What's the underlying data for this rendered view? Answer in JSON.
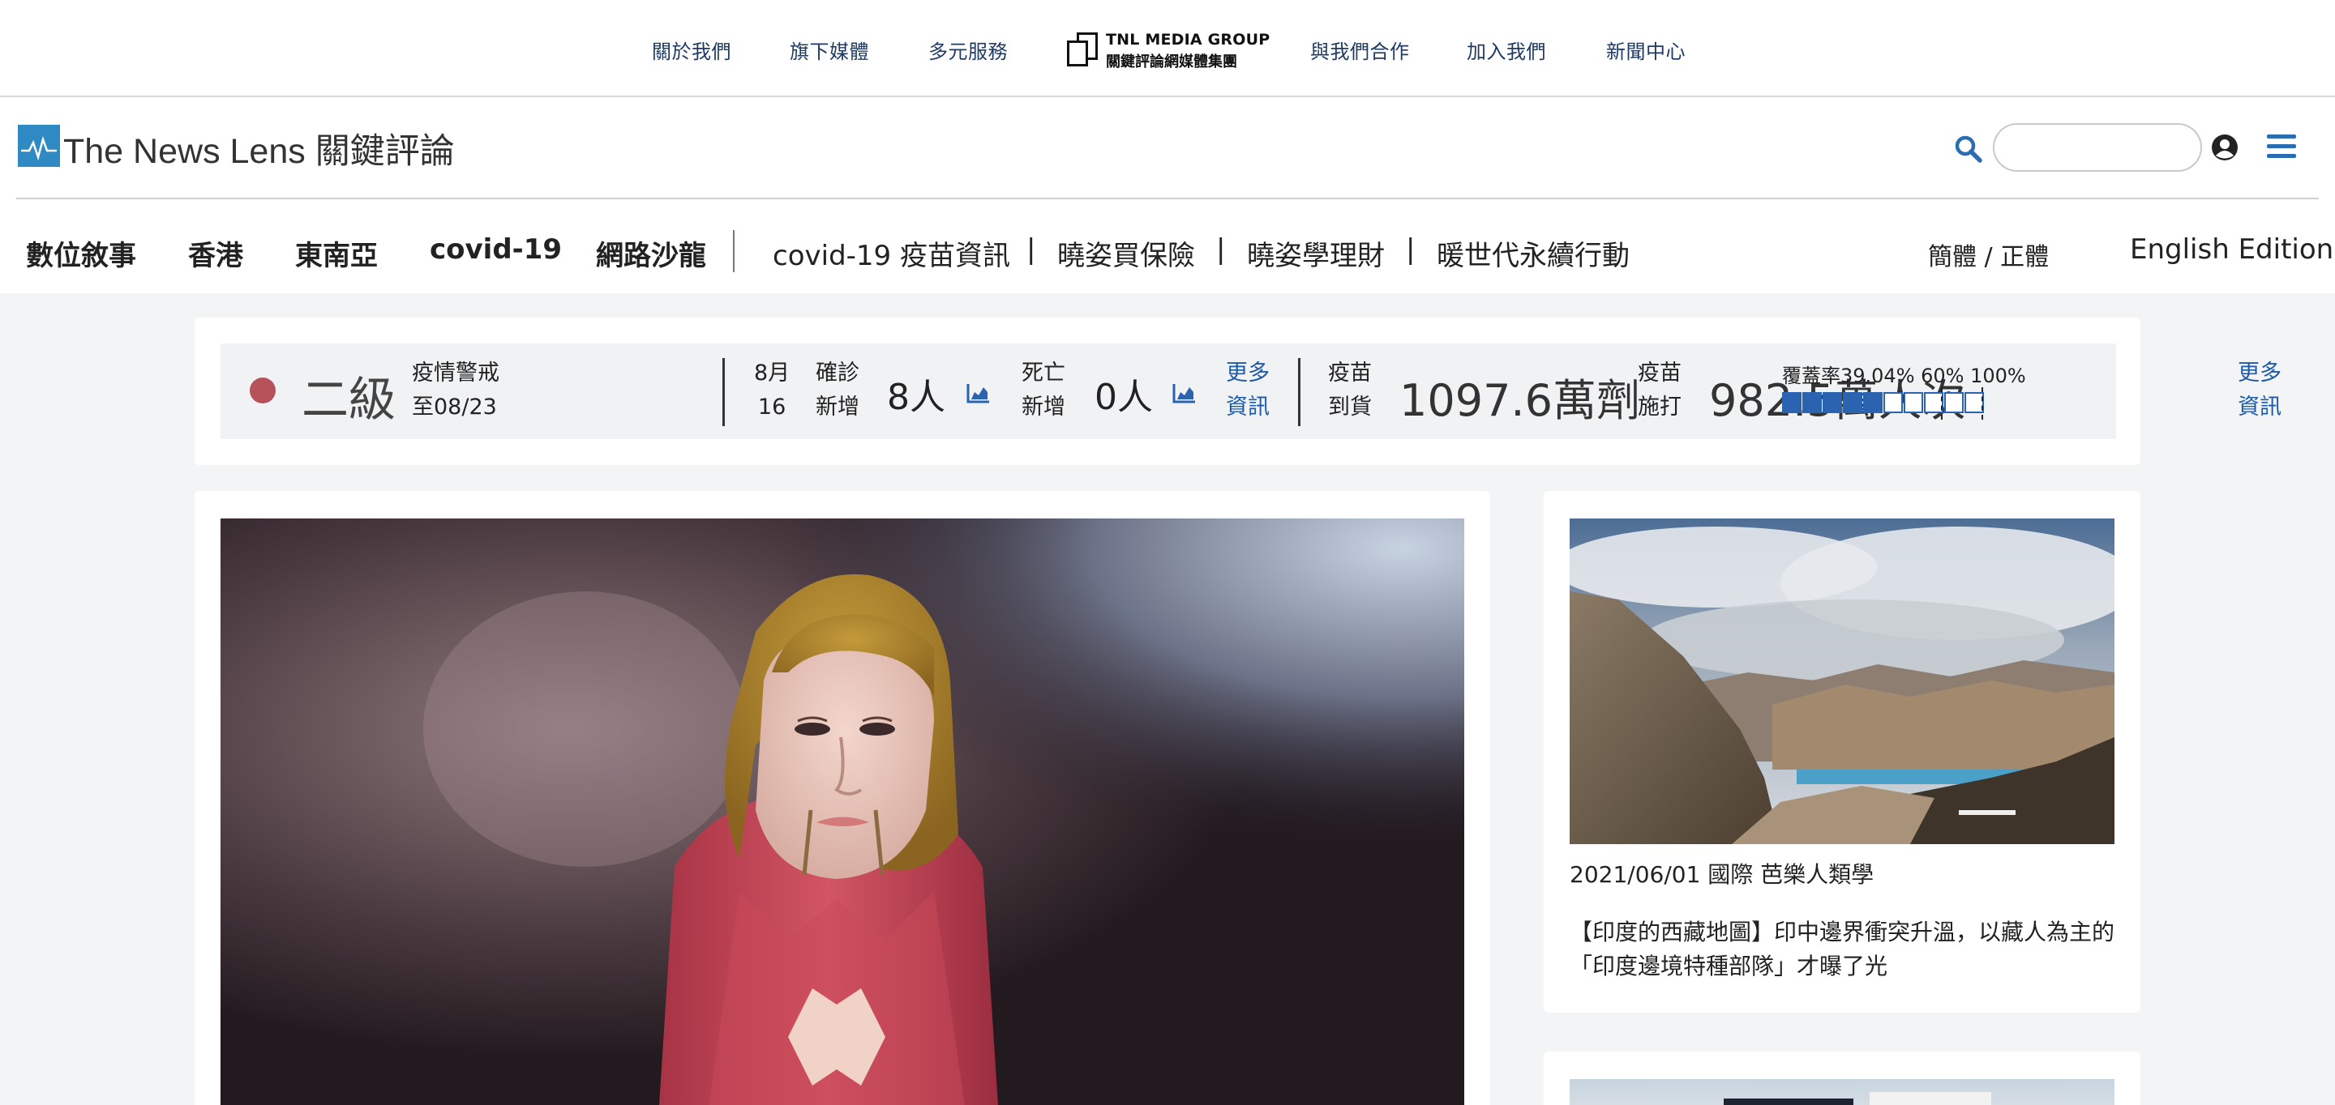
{
  "group_bar": {
    "links": [
      "關於我們",
      "旗下媒體",
      "多元服務",
      "與我們合作",
      "加入我們",
      "新聞中心"
    ],
    "logo_line1": "TNL MEDIA GROUP",
    "logo_line2": "關鍵評論網媒體集團"
  },
  "header": {
    "logo_text": "The News Lens 關鍵評論",
    "search_placeholder": "",
    "icons": [
      "search-icon",
      "user-icon",
      "menu-icon"
    ],
    "brand_color": "#2f8ac4"
  },
  "nav": {
    "primary": [
      "數位敘事",
      "香港",
      "東南亞",
      "covid-19",
      "網路沙龍"
    ],
    "secondary": [
      "covid-19 疫苗資訊",
      "曉姿買保險",
      "曉姿學理財",
      "暖世代永續行動"
    ],
    "separator": "|",
    "language": "簡體 / 正體",
    "edition": "English Edition"
  },
  "covid": {
    "level": "二級",
    "alert_line1": "疫情警戒",
    "alert_line2": "至08/23",
    "date_month": "8月",
    "date_day": "16",
    "confirmed_label1": "確診",
    "confirmed_label2": "新增",
    "confirmed_value": "8人",
    "death_label1": "死亡",
    "death_label2": "新增",
    "death_value": "0人",
    "more1_line1": "更多",
    "more1_line2": "資訊",
    "vaccine_arrival_label1": "疫苗",
    "vaccine_arrival_label2": "到貨",
    "vaccine_arrival_value": "1097.6萬劑",
    "vaccine_given_label1": "疫苗",
    "vaccine_given_label2": "施打",
    "vaccine_given_value": "982.5萬人次",
    "coverage_label": "覆蓋率39.04% 60% 100%",
    "coverage_percent": 39.04,
    "coverage_segments_total": 10,
    "coverage_segments_filled": 5,
    "more2_line1": "更多",
    "more2_line2": "資訊",
    "alert_color": "#b5525a",
    "accent_color": "#2a63b0"
  },
  "main_article": {
    "image": "hero-photo"
  },
  "side_article": {
    "image": "mountain-lake-photo",
    "meta": "2021/06/01 國際 芭樂人類學",
    "title": "【印度的西藏地圖】印中邊界衝突升溫，以藏人為主的「印度邊境特種部隊」才曝了光"
  }
}
